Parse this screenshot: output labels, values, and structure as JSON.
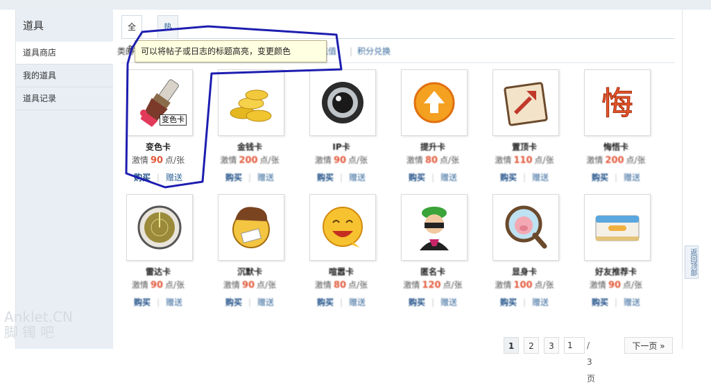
{
  "sidebar": {
    "title": "道具",
    "items": [
      {
        "label": "道具商店",
        "active": true
      },
      {
        "label": "我的道具",
        "active": false
      },
      {
        "label": "道具记录",
        "active": false
      }
    ]
  },
  "tabs": [
    {
      "label": "全部",
      "active": true
    },
    {
      "label": "热门",
      "active": false
    }
  ],
  "filter": {
    "label_fragment": "类的",
    "links": [
      "积分充值",
      "积分兑换"
    ]
  },
  "tooltip": {
    "text": "可以将帖子或日志的标题高亮，变更颜色"
  },
  "hover_label": "变色卡",
  "price_prefix": "激情",
  "price_suffix": "点/张",
  "buy_label": "购买",
  "gift_label": "赠送",
  "items": [
    {
      "name": "变色卡",
      "price": "90",
      "icon": "paint-brush-icon"
    },
    {
      "name": "金钱卡",
      "price": "200",
      "icon": "gold-coins-icon"
    },
    {
      "name": "IP卡",
      "price": "90",
      "icon": "camera-lens-icon"
    },
    {
      "name": "提升卡",
      "price": "80",
      "icon": "up-arrow-icon"
    },
    {
      "name": "置顶卡",
      "price": "110",
      "icon": "pin-top-icon"
    },
    {
      "name": "悔悟卡",
      "price": "200",
      "icon": "regret-icon"
    },
    {
      "name": "雷达卡",
      "price": "90",
      "icon": "radar-icon"
    },
    {
      "name": "沉默卡",
      "price": "90",
      "icon": "silence-face-icon"
    },
    {
      "name": "喧嚣卡",
      "price": "80",
      "icon": "laughing-face-icon"
    },
    {
      "name": "匿名卡",
      "price": "120",
      "icon": "anonymous-avatar-icon"
    },
    {
      "name": "显身卡",
      "price": "100",
      "icon": "magnifier-pig-icon"
    },
    {
      "name": "好友推荐卡",
      "price": "90",
      "icon": "recommend-card-icon"
    }
  ],
  "pagination": {
    "pages": [
      "1",
      "2",
      "3"
    ],
    "current": "1",
    "input_value": "1",
    "total_label": "/ 3 页",
    "next_label": "下一页 »"
  },
  "side_widget": "返回顶部",
  "watermark": {
    "line1": "Anklet.CN",
    "line2": "脚镯吧"
  },
  "colors": {
    "sidebar_bg": "#e8eef4",
    "price_red": "#e2583a",
    "link_blue": "#336699",
    "tooltip_bg": "#ffffe1",
    "annotation_stroke": "#1d1db0"
  }
}
